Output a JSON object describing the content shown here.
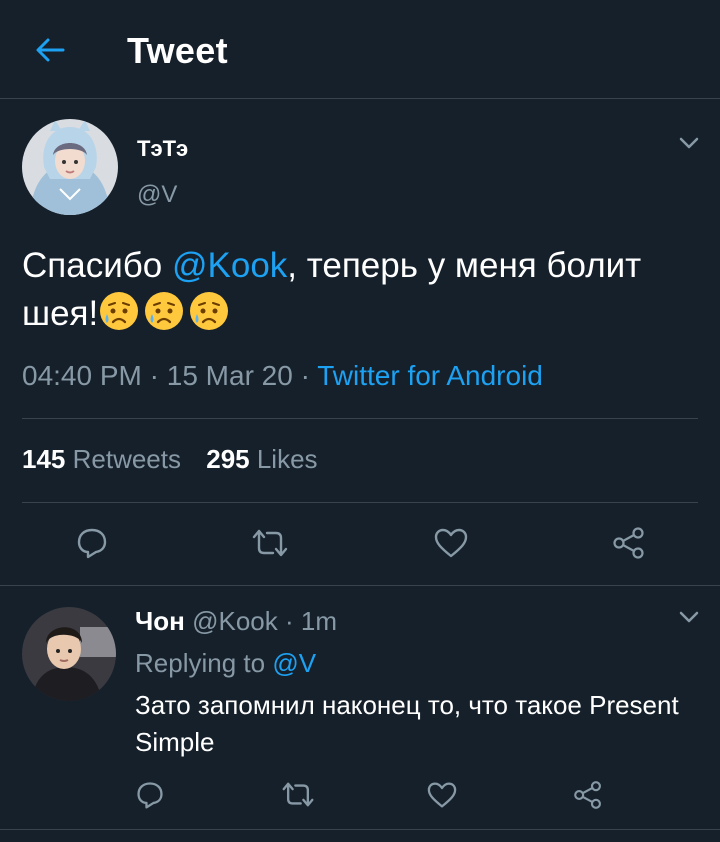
{
  "header": {
    "title": "Tweet"
  },
  "tweet": {
    "author_name": "ТэТэ",
    "author_handle": "@V",
    "text_before": "Спасибо ",
    "mention": "@Kook",
    "text_after": ", теперь у меня болит шея!",
    "emojis": [
      "sad-relieved-face",
      "sad-relieved-face",
      "sad-relieved-face"
    ],
    "time": "04:40 PM",
    "dot1": " · ",
    "date": "15 Mar 20",
    "dot2": " · ",
    "source": "Twitter for Android",
    "retweets_count": "145",
    "retweets_label": " Retweets",
    "likes_count": "295",
    "likes_label": " Likes"
  },
  "reply": {
    "author_name": "Чон",
    "author_handle": " @Kook",
    "dot": " · ",
    "time": "1m",
    "replying_prefix": "Replying to ",
    "replying_to": "@V",
    "text": "Зато запомнил наконец то, что такое Present Simple"
  },
  "colors": {
    "background": "#15202b",
    "accent": "#1da1f2",
    "secondary_text": "#8899a6",
    "divider": "#38444d"
  }
}
